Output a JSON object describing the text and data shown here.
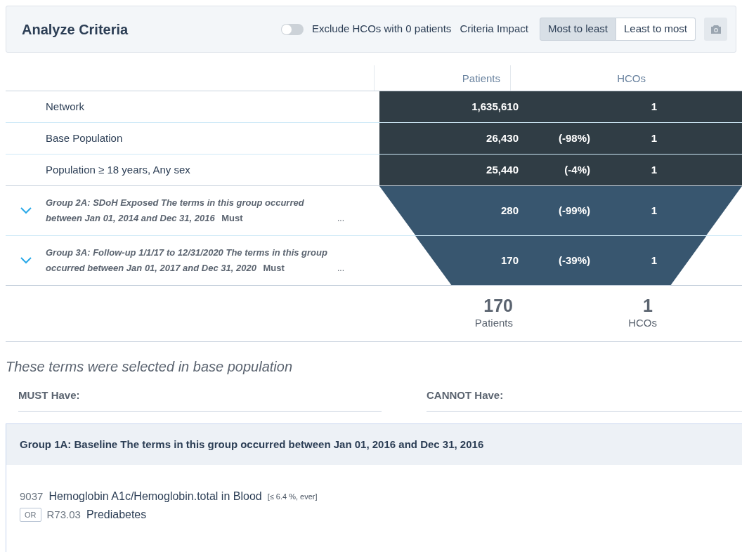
{
  "header": {
    "title": "Analyze Criteria",
    "toggle": {
      "label": "Exclude HCOs with 0 patients",
      "on": false
    },
    "impact_label": "Criteria Impact",
    "sort_options": [
      {
        "label": "Most to least",
        "selected": true
      },
      {
        "label": "Least to most",
        "selected": false
      }
    ]
  },
  "table": {
    "columns": [
      "Patients",
      "HCOs"
    ],
    "rows": [
      {
        "kind": "bar",
        "label": "Network",
        "patients": "1,635,610",
        "hcos": "1"
      },
      {
        "kind": "bar",
        "label": "Base Population",
        "patients": "26,430",
        "change": "(-98%)",
        "hcos": "1"
      },
      {
        "kind": "bar",
        "label": "Population ≥ 18 years, Any sex",
        "patients": "25,440",
        "change": "(-4%)",
        "hcos": "1"
      },
      {
        "kind": "funnel",
        "label": "Group 2A: SDoH Exposed The terms in this group occurred between Jan 01, 2014 and Dec 31, 2016",
        "must": "Must",
        "more": "...",
        "expanded": false,
        "patients": "280",
        "change": "(-99%)",
        "hcos": "1"
      },
      {
        "kind": "funnel",
        "label": "Group 3A: Follow-up 1/1/17 to 12/31/2020 The terms in this group occurred between Jan 01, 2017 and Dec 31, 2020",
        "must": "Must",
        "more": "...",
        "expanded": false,
        "patients": "170",
        "change": "(-39%)",
        "hcos": "1"
      }
    ],
    "totals": [
      {
        "value": "170",
        "label": "Patients"
      },
      {
        "value": "1",
        "label": "HCOs"
      }
    ]
  },
  "base_terms": {
    "title": "These terms were selected in base population",
    "must_label": "MUST Have:",
    "cannot_label": "CANNOT Have:"
  },
  "group": {
    "title": "Group 1A: Baseline The terms in this group occurred between Jan 01, 2016 and Dec 31, 2016",
    "terms": [
      {
        "code": "9037",
        "name": "Hemoglobin A1c/Hemoglobin.total in Blood",
        "qualifier": "[≤ 6.4 %, ever]"
      },
      {
        "operator": "OR",
        "code": "R73.03",
        "name": "Prediabetes"
      }
    ]
  }
}
